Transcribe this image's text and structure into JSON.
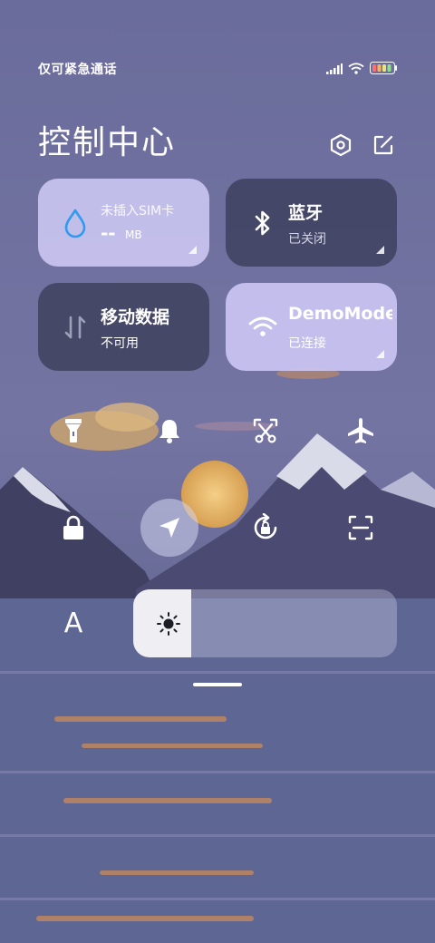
{
  "status_bar": {
    "carrier": "仅可紧急通话",
    "icons": [
      "signal-icon",
      "wifi-icon",
      "battery-icon"
    ]
  },
  "header": {
    "title": "控制中心",
    "icons": [
      "settings-icon",
      "edit-icon"
    ]
  },
  "tiles": {
    "data_usage": {
      "label": "未插入SIM卡",
      "value": "--",
      "unit": "MB",
      "icon": "water-drop-icon"
    },
    "bluetooth": {
      "label": "蓝牙",
      "status": "已关闭",
      "icon": "bluetooth-icon"
    },
    "mobile_data": {
      "label": "移动数据",
      "status": "不可用",
      "icon": "data-arrows-icon"
    },
    "wifi": {
      "label": "DemoMode",
      "status": "已连接",
      "icon": "wifi-icon"
    }
  },
  "quick_toggles": [
    {
      "name": "flashlight",
      "icon": "flashlight-icon",
      "active": false
    },
    {
      "name": "ring",
      "icon": "bell-icon",
      "active": false
    },
    {
      "name": "screenshot",
      "icon": "scissors-icon",
      "active": false
    },
    {
      "name": "airplane",
      "icon": "airplane-icon",
      "active": false
    },
    {
      "name": "lock",
      "icon": "lock-icon",
      "active": false
    },
    {
      "name": "location",
      "icon": "location-icon",
      "active": true
    },
    {
      "name": "auto-rotate",
      "icon": "rotate-lock-icon",
      "active": false
    },
    {
      "name": "scanner",
      "icon": "scan-icon",
      "active": false
    }
  ],
  "bottom_row": {
    "font_size_label": "A",
    "brightness_level": 0.22
  },
  "colors": {
    "sky": "#6f6f9e",
    "tile_active": "#cec8f5",
    "tile_inactive": "#3a3c58",
    "drop_blue": "#2f9bf0"
  }
}
